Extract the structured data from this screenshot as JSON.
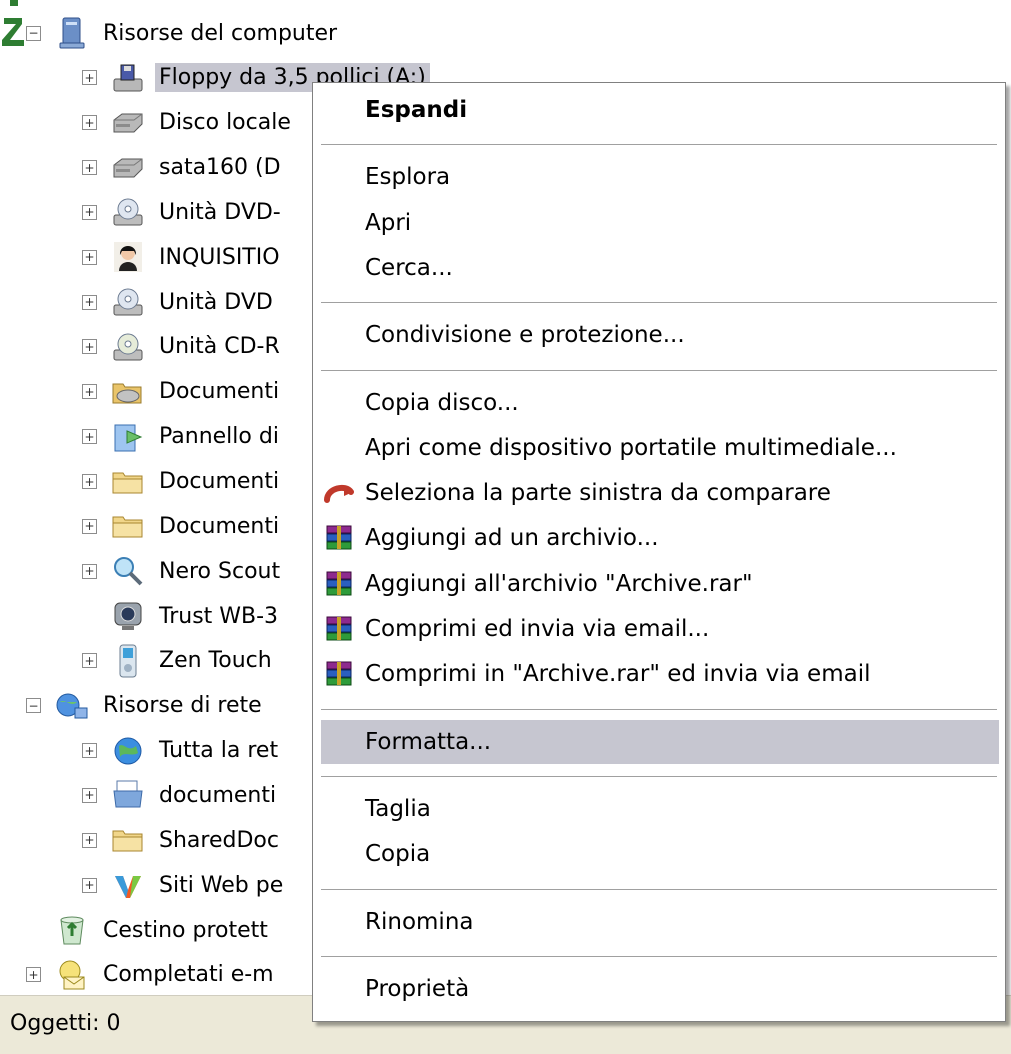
{
  "tree": {
    "items": [
      {
        "label": "Risorse del computer",
        "expander": "−",
        "icon": "computer-icon",
        "level": 0
      },
      {
        "label": "Floppy da 3,5 pollici (A:)",
        "expander": "+",
        "icon": "floppy-drive-icon",
        "level": 1,
        "selected": true
      },
      {
        "label": "Disco locale",
        "expander": "+",
        "icon": "hard-disk-icon",
        "level": 1
      },
      {
        "label": "sata160 (D",
        "expander": "+",
        "icon": "hard-disk-icon",
        "level": 1
      },
      {
        "label": "Unità DVD-",
        "expander": "+",
        "icon": "dvd-drive-icon",
        "level": 1
      },
      {
        "label": "INQUISITIO",
        "expander": "+",
        "icon": "user-avatar-icon",
        "level": 1
      },
      {
        "label": "Unità DVD",
        "expander": "+",
        "icon": "dvd-drive-icon",
        "level": 1
      },
      {
        "label": "Unità CD-R",
        "expander": "+",
        "icon": "cd-drive-icon",
        "level": 1
      },
      {
        "label": "Documenti",
        "expander": "+",
        "icon": "shared-documents-icon",
        "level": 1
      },
      {
        "label": "Pannello di",
        "expander": "+",
        "icon": "control-panel-icon",
        "level": 1
      },
      {
        "label": "Documenti",
        "expander": "+",
        "icon": "folder-icon",
        "level": 1
      },
      {
        "label": "Documenti",
        "expander": "+",
        "icon": "folder-icon",
        "level": 1
      },
      {
        "label": "Nero Scout",
        "expander": "+",
        "icon": "nero-scout-icon",
        "level": 1
      },
      {
        "label": "Trust WB-3",
        "expander": "",
        "icon": "webcam-icon",
        "level": 1
      },
      {
        "label": "Zen Touch",
        "expander": "+",
        "icon": "mp3-player-icon",
        "level": 1
      },
      {
        "label": "Risorse di rete",
        "expander": "−",
        "icon": "network-icon",
        "level": 0
      },
      {
        "label": "Tutta la ret",
        "expander": "+",
        "icon": "globe-icon",
        "level": 1
      },
      {
        "label": "documenti",
        "expander": "+",
        "icon": "network-folder-icon",
        "level": 1
      },
      {
        "label": "SharedDoc",
        "expander": "+",
        "icon": "folder-icon",
        "level": 1
      },
      {
        "label": "Siti Web pe",
        "expander": "+",
        "icon": "msn-sites-icon",
        "level": 1
      },
      {
        "label": "Cestino protett",
        "expander": "",
        "icon": "recycle-bin-icon",
        "level": 0
      },
      {
        "label": "Completati e-m",
        "expander": "+",
        "icon": "completed-email-icon",
        "level": 0
      }
    ]
  },
  "status": {
    "text": "Oggetti: 0"
  },
  "context_menu": {
    "entries": [
      {
        "type": "item",
        "label": "Espandi",
        "bold": true,
        "icon": ""
      },
      {
        "type": "sep"
      },
      {
        "type": "item",
        "label": "Esplora",
        "icon": ""
      },
      {
        "type": "item",
        "label": "Apri",
        "icon": ""
      },
      {
        "type": "item",
        "label": "Cerca...",
        "icon": ""
      },
      {
        "type": "sep"
      },
      {
        "type": "item",
        "label": "Condivisione e protezione...",
        "icon": ""
      },
      {
        "type": "sep"
      },
      {
        "type": "item",
        "label": "Copia disco...",
        "icon": ""
      },
      {
        "type": "item",
        "label": "Apri come dispositivo portatile multimediale...",
        "icon": ""
      },
      {
        "type": "item",
        "label": "Seleziona la parte sinistra da comparare",
        "icon": "compare-icon"
      },
      {
        "type": "item",
        "label": "Aggiungi ad un archivio...",
        "icon": "winrar-icon"
      },
      {
        "type": "item",
        "label": "Aggiungi all'archivio \"Archive.rar\"",
        "icon": "winrar-icon"
      },
      {
        "type": "item",
        "label": "Comprimi ed invia via email...",
        "icon": "winrar-icon"
      },
      {
        "type": "item",
        "label": "Comprimi in \"Archive.rar\" ed invia via email",
        "icon": "winrar-icon"
      },
      {
        "type": "sep"
      },
      {
        "type": "item",
        "label": "Formatta...",
        "icon": "",
        "highlighted": true
      },
      {
        "type": "sep"
      },
      {
        "type": "item",
        "label": "Taglia",
        "icon": ""
      },
      {
        "type": "item",
        "label": "Copia",
        "icon": ""
      },
      {
        "type": "sep"
      },
      {
        "type": "item",
        "label": "Rinomina",
        "icon": ""
      },
      {
        "type": "sep"
      },
      {
        "type": "item",
        "label": "Proprietà",
        "icon": ""
      }
    ]
  },
  "colors": {
    "selection": "#c6c6d0",
    "statusbar": "#ece9d8",
    "corner_glyph": "#2e7d32"
  }
}
